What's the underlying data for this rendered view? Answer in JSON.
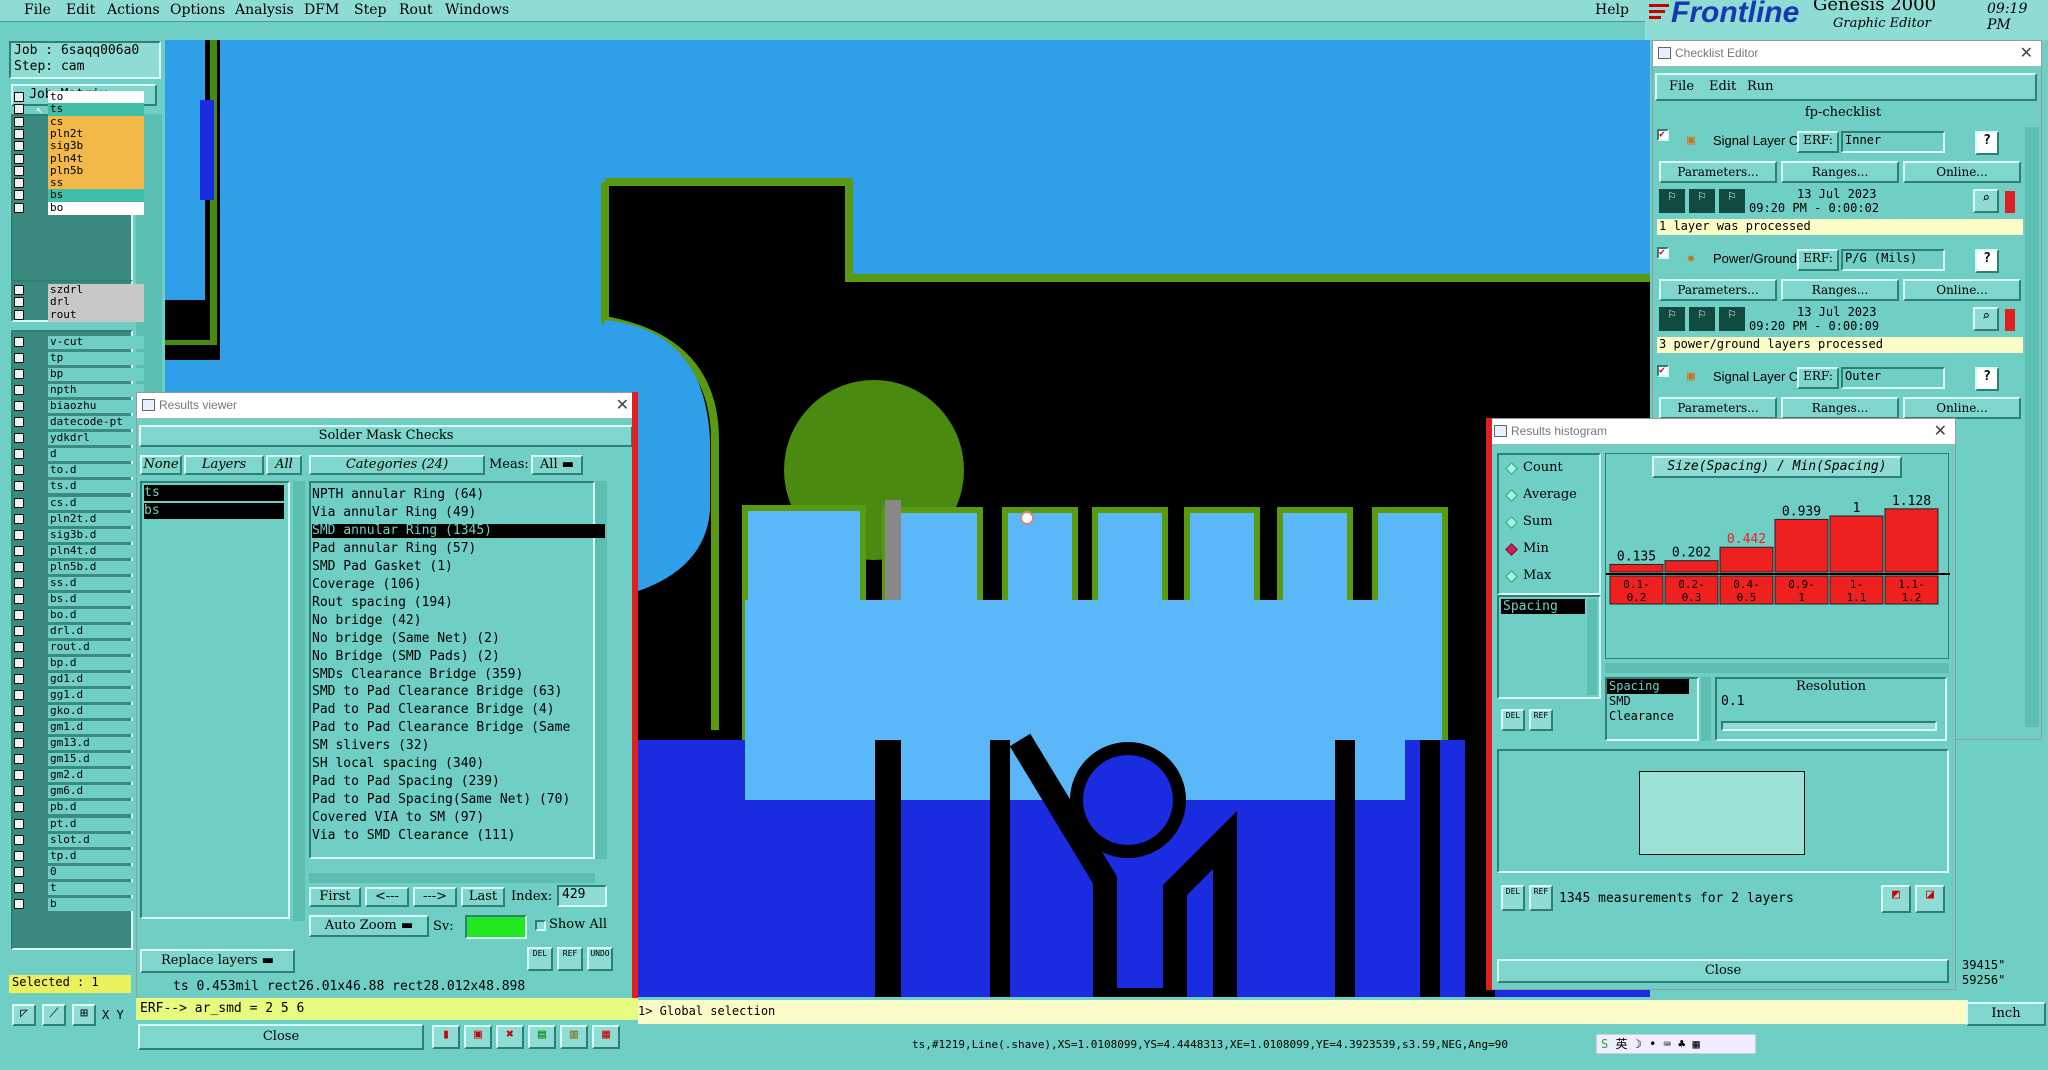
{
  "menu": {
    "items": [
      "File",
      "Edit",
      "Actions",
      "Options",
      "Analysis",
      "DFM",
      "Step",
      "Rout",
      "Windows"
    ],
    "help": "Help",
    "brand": "Frontline",
    "product": "Genesis 2000",
    "subtitle": "Graphic Editor",
    "time": "09:19 PM"
  },
  "job": {
    "job_label": "Job : 6saqq006a0",
    "step_label": "Step: cam",
    "matrix_button": "Job Matrix ..."
  },
  "layers": {
    "group1": [
      {
        "name": "to",
        "color": "#ffffff"
      },
      {
        "name": "ts",
        "color": "#3fbfa6",
        "selected": true
      },
      {
        "name": "cs",
        "color": "#f2b84a"
      },
      {
        "name": "pln2t",
        "color": "#f2b84a"
      },
      {
        "name": "sig3b",
        "color": "#f2b84a"
      },
      {
        "name": "pln4t",
        "color": "#f2b84a"
      },
      {
        "name": "pln5b",
        "color": "#f2b84a"
      },
      {
        "name": "ss",
        "color": "#f2b84a"
      },
      {
        "name": "bs",
        "color": "#3fbfa6"
      },
      {
        "name": "bo",
        "color": "#ffffff"
      }
    ],
    "group2": [
      {
        "name": "szdrl",
        "color": "#c8c8c8"
      },
      {
        "name": "drl",
        "color": "#c8c8c8"
      },
      {
        "name": "rout",
        "color": "#c8c8c8"
      }
    ],
    "group3": [
      "v-cut",
      "tp",
      "bp",
      "npth",
      "biaozhu",
      "datecode-pt",
      "ydkdrl",
      "d",
      "to.d",
      "ts.d",
      "cs.d",
      "pln2t.d",
      "sig3b.d",
      "pln4t.d",
      "pln5b.d",
      "ss.d",
      "bs.d",
      "bo.d",
      "drl.d",
      "rout.d",
      "bp.d",
      "gd1.d",
      "gg1.d",
      "gko.d",
      "gm1.d",
      "gm13.d",
      "gm15.d",
      "gm2.d",
      "gm6.d",
      "pb.d",
      "pt.d",
      "slot.d",
      "tp.d",
      "0",
      "t",
      "b"
    ],
    "selected_count": "Selected : 1"
  },
  "results_viewer": {
    "title": "Results viewer",
    "header": "Solder Mask Checks",
    "btn_none": "None",
    "btn_layers": "Layers",
    "btn_all": "All",
    "categories_label": "Categories (24)",
    "meas_label": "Meas:",
    "meas_value": "All",
    "layer_list": [
      "ts",
      "bs"
    ],
    "categories": [
      "NPTH annular Ring (64)",
      "Via annular Ring (49)",
      "SMD annular Ring (1345)",
      "Pad annular Ring (57)",
      "SMD Pad Gasket (1)",
      "Coverage (106)",
      "Rout spacing (194)",
      "No bridge (42)",
      "No bridge (Same Net) (2)",
      "No Bridge (SMD Pads) (2)",
      "SMDs Clearance Bridge (359)",
      "SMD to Pad Clearance Bridge (63)",
      "Pad to Pad Clearance Bridge (4)",
      "Pad to Pad Clearance Bridge (Same",
      "SM slivers (32)",
      "SH local spacing (340)",
      "Pad to Pad Spacing (239)",
      "Pad to Pad Spacing(Same Net) (70)",
      "Covered VIA to SM (97)",
      "Via to SMD Clearance (111)"
    ],
    "selected_category": 2,
    "nav": {
      "first": "First",
      "prev": "<---",
      "next": "--->",
      "last": "Last",
      "index_label": "Index:",
      "index_value": "429"
    },
    "auto_zoom": "Auto Zoom",
    "sv_label": "Sv:",
    "show_all": "Show All",
    "replace_layers": "Replace layers",
    "icons": [
      "DEL",
      "REF",
      "UNDO"
    ],
    "status_line": "ts 0.453mil  rect26.01x46.88  rect28.012x48.898"
  },
  "erf_line": "ERF--> ar_smd = 2 5 6",
  "close_button": "Close",
  "global_selection": "1> Global selection",
  "bottom_status": "ts,#1219,Line(.shave),XS=1.0108099,YS=4.4448313,XE=1.0108099,YE=4.3923539,s3.59,NEG,Ang=90",
  "units": "Inch",
  "coords": [
    "39415\"",
    "59256\""
  ],
  "ime": "英",
  "checklist": {
    "title": "Checklist Editor",
    "menu": [
      "File",
      "Edit",
      "Run"
    ],
    "name": "fp-checklist",
    "checks": [
      {
        "name": "Signal Layer Ch",
        "erf_label": "ERF:",
        "erf": "Inner",
        "date": "13 Jul 2023",
        "time": "09:20 PM - 0:00:02",
        "status": "1 layer was processed"
      },
      {
        "name": "Power/Ground C",
        "erf_label": "ERF:",
        "erf": "P/G (Mils)",
        "date": "13 Jul 2023",
        "time": "09:20 PM - 0:00:09",
        "status": "3 power/ground layers processed"
      },
      {
        "name": "Signal Layer Ch",
        "erf_label": "ERF:",
        "erf": "Outer"
      }
    ],
    "buttons": [
      "Parameters...",
      "Ranges...",
      "Online..."
    ]
  },
  "histogram": {
    "title": "Results histogram",
    "modes": [
      "Count",
      "Average",
      "Sum",
      "Min",
      "Max"
    ],
    "selected_mode": "Min",
    "measure_list": [
      "Spacing"
    ],
    "chart_title": "Size(Spacing) / Min(Spacing)",
    "size_list": [
      "Spacing",
      "SMD",
      "Clearance"
    ],
    "resolution_label": "Resolution",
    "resolution_value": "0.1",
    "summary": "1345 measurements for 2 layers",
    "close": "Close",
    "icons": [
      "DEL",
      "REF"
    ]
  },
  "chart_data": {
    "type": "bar",
    "title": "Size(Spacing) / Min(Spacing)",
    "categories": [
      "0.1-0.2",
      "0.2-0.3",
      "0.4-0.5",
      "0.9-1",
      "1-1.1",
      "1.1-1.2"
    ],
    "values": [
      0.135,
      0.202,
      0.442,
      0.939,
      1,
      1.128
    ],
    "labels": [
      "0.135",
      "0.202",
      "0.442",
      "0.939",
      "1",
      "1.128"
    ],
    "tick_labels": [
      [
        "0.1-",
        "0.2"
      ],
      [
        "0.2-",
        "0.3"
      ],
      [
        "0.4-",
        "0.5"
      ],
      [
        "0.9-",
        "1"
      ],
      [
        "1-",
        "1.1"
      ],
      [
        "1.1-",
        "1.2"
      ]
    ],
    "highlighted_index": 2,
    "ylim": [
      0,
      1.25
    ],
    "colors": {
      "bar": "#ee2020",
      "highlight_label": "#ee2020"
    }
  }
}
